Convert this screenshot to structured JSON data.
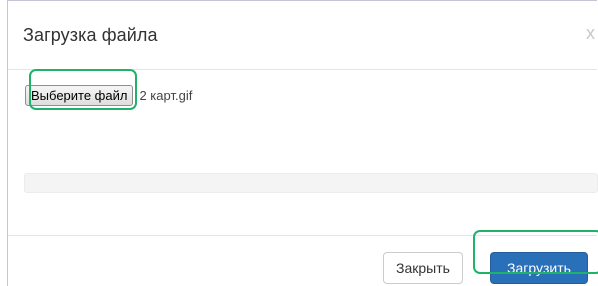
{
  "dialog": {
    "title": "Загрузка файла",
    "close_glyph": "x"
  },
  "file_input": {
    "button_label": "Выберите файл",
    "selected_file": "2 карт.gif"
  },
  "progress": {
    "value": 0
  },
  "footer": {
    "close_label": "Закрыть",
    "upload_label": "Загрузить"
  },
  "colors": {
    "primary": "#2a70b8",
    "highlight": "#1fb26a"
  }
}
